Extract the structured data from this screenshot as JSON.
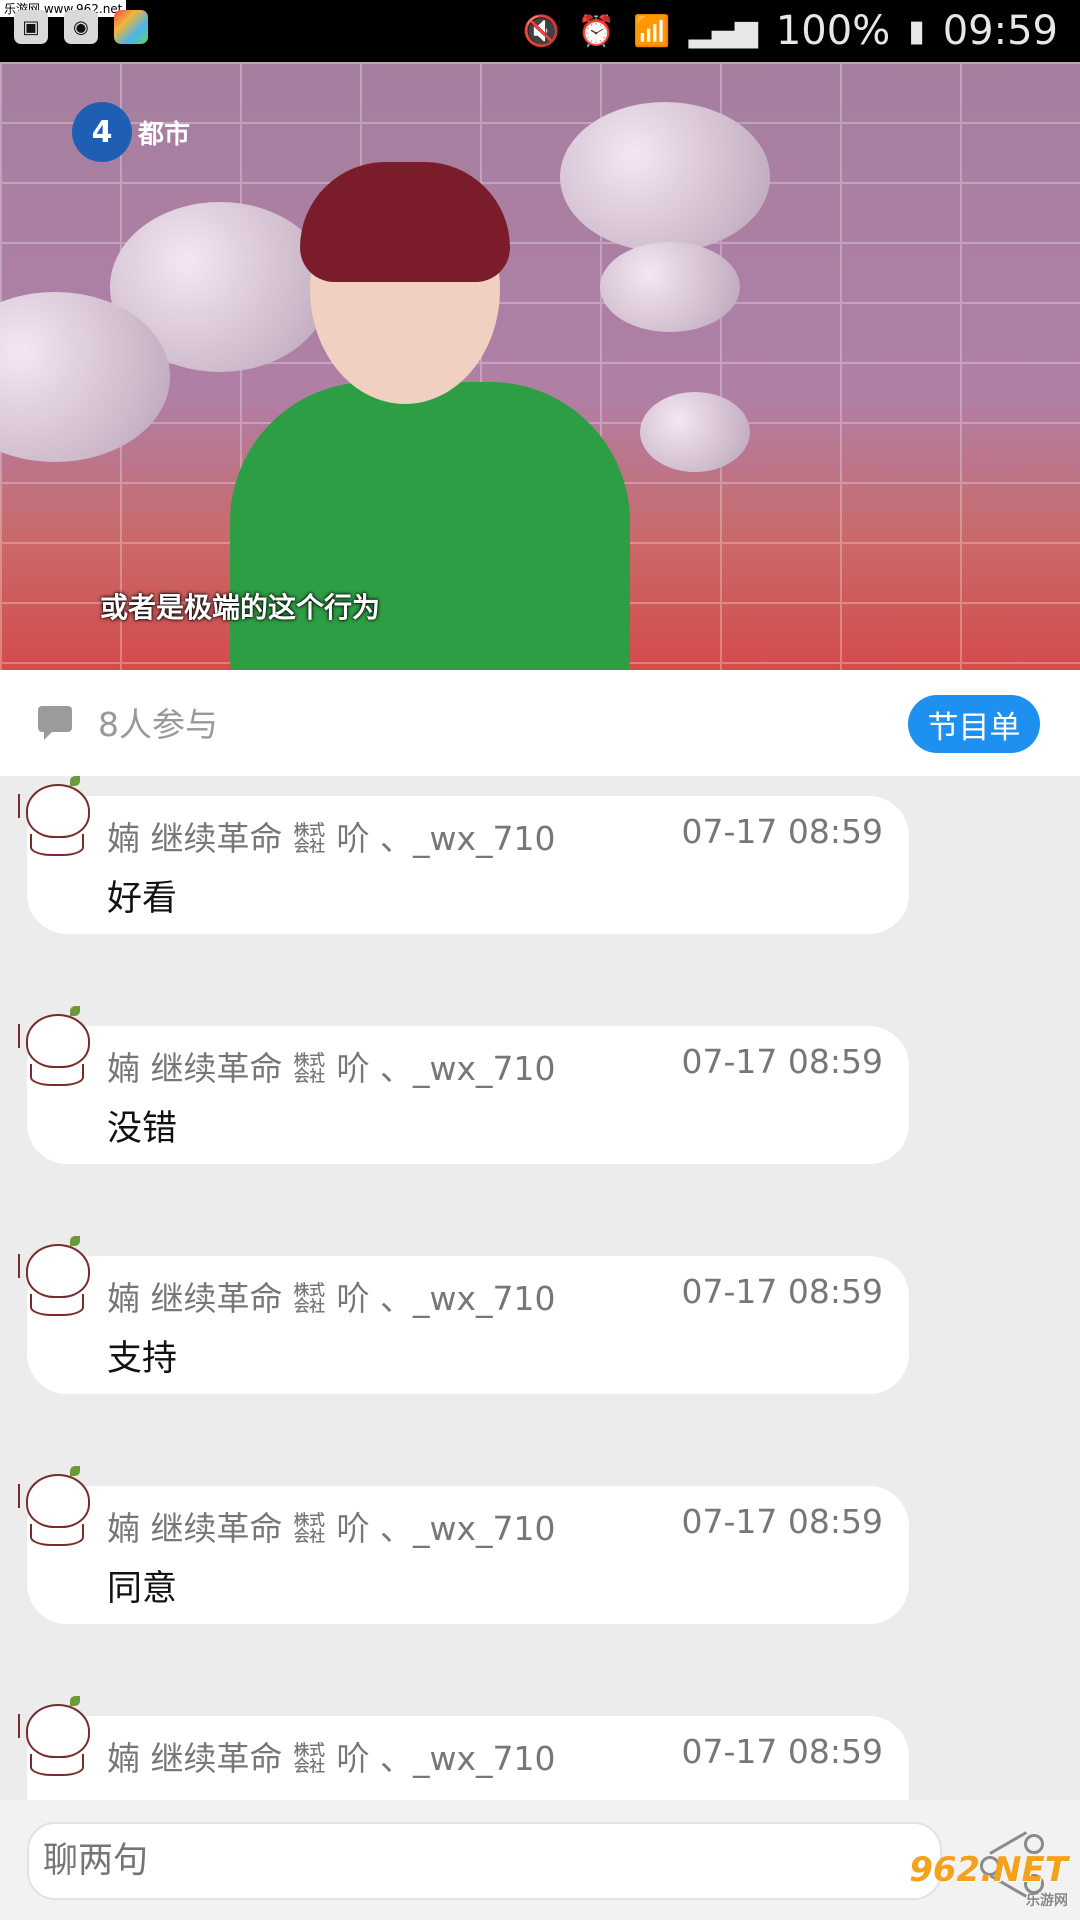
{
  "status_bar": {
    "watermark": "乐游网 www.962.net",
    "battery": "100%",
    "time": "09:59",
    "icons": [
      "gallery-icon",
      "app-icon",
      "camera-icon",
      "mute-icon",
      "alarm-icon",
      "wifi-icon",
      "signal-icon",
      "battery-icon"
    ]
  },
  "video": {
    "channel_name": "都市",
    "channel_number": "4",
    "subtitle": "或者是极端的这个行为"
  },
  "info": {
    "participants": "8人参与",
    "program_button": "节目单"
  },
  "messages": [
    {
      "user": "婻 继续革命 ㍿ 吤 、_wx_710",
      "time": "07-17 08:59",
      "text": "好看"
    },
    {
      "user": "婻 继续革命 ㍿ 吤 、_wx_710",
      "time": "07-17 08:59",
      "text": "没错"
    },
    {
      "user": "婻 继续革命 ㍿ 吤 、_wx_710",
      "time": "07-17 08:59",
      "text": "支持"
    },
    {
      "user": "婻 继续革命 ㍿ 吤 、_wx_710",
      "time": "07-17 08:59",
      "text": "同意"
    },
    {
      "user": "婻 继续革命 ㍿ 吤 、_wx_710",
      "time": "07-17 08:59",
      "text": ""
    }
  ],
  "input": {
    "placeholder": "聊两句"
  },
  "corner_watermark": {
    "main": "962.NET",
    "sub": "乐游网"
  },
  "colors": {
    "accent": "#1e90f0",
    "background": "#ececec"
  }
}
